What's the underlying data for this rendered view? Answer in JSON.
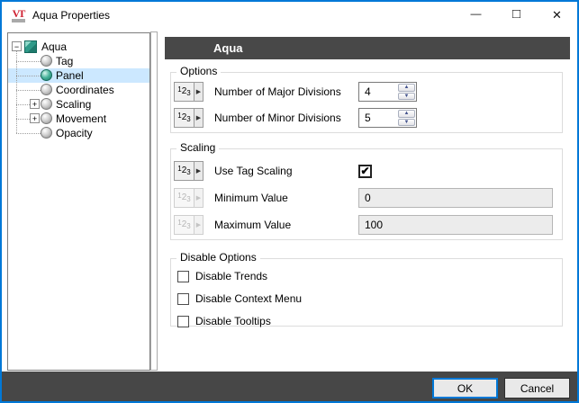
{
  "window": {
    "title": "Aqua Properties",
    "logo_text": "VT"
  },
  "icons": {
    "minimize": "—",
    "maximize": "□",
    "close": "✕",
    "dropdown_arrow": "▶",
    "check": "✔",
    "expander_expanded": "−",
    "expander_collapsed": "+",
    "spin_up": "▲",
    "spin_down": "▼"
  },
  "colors": {
    "accent_border": "#0078d7",
    "header_bar": "#484848",
    "footer_bar": "#474747",
    "tree_selection": "#cce8ff",
    "selected_node_green": "#2f9a89"
  },
  "tree": {
    "root_label": "Aqua",
    "items": [
      {
        "label": "Tag",
        "selected": false
      },
      {
        "label": "Panel",
        "selected": true
      },
      {
        "label": "Coordinates",
        "selected": false
      },
      {
        "label": "Scaling",
        "selected": false,
        "expandable": true
      },
      {
        "label": "Movement",
        "selected": false,
        "expandable": true
      },
      {
        "label": "Opacity",
        "selected": false
      }
    ]
  },
  "panel": {
    "header_title": "Aqua",
    "num_button": {
      "sup": "1",
      "mid": "2",
      "sub": "3"
    },
    "options": {
      "title": "Options",
      "rows": [
        {
          "label": "Number of Major Divisions",
          "value": "4"
        },
        {
          "label": "Number of Minor Divisions",
          "value": "5"
        }
      ]
    },
    "scaling": {
      "title": "Scaling",
      "use_tag_scaling": {
        "label": "Use Tag Scaling",
        "checked": true
      },
      "minimum": {
        "label": "Minimum Value",
        "value": "0",
        "disabled": true
      },
      "maximum": {
        "label": "Maximum Value",
        "value": "100",
        "disabled": true
      }
    },
    "disable": {
      "title": "Disable Options",
      "items": [
        {
          "label": "Disable Trends",
          "checked": false
        },
        {
          "label": "Disable Context Menu",
          "checked": false
        },
        {
          "label": "Disable Tooltips",
          "checked": false
        }
      ]
    }
  },
  "footer": {
    "ok": "OK",
    "cancel": "Cancel"
  }
}
